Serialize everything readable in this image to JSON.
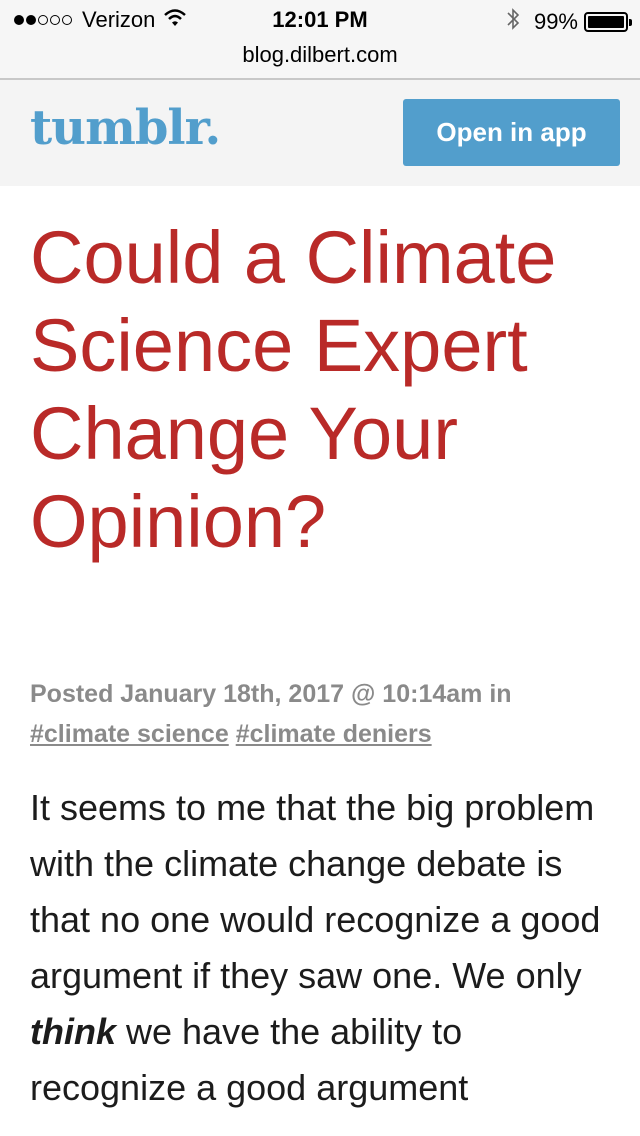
{
  "status_bar": {
    "carrier": "Verizon",
    "time": "12:01 PM",
    "battery": "99%",
    "icons": [
      "signal-dots",
      "wifi-icon",
      "bluetooth-icon",
      "battery-icon"
    ]
  },
  "browser": {
    "url": "blog.dilbert.com"
  },
  "header": {
    "logo": "tumblr.",
    "open_app_label": "Open in app",
    "brand_color": "#529ecc"
  },
  "post": {
    "title": "Could a Climate Science Expert Change Your Opinion?",
    "title_color": "#b92a28",
    "meta": {
      "posted_text": "Posted January 18th, 2017 @ 10:14am in",
      "tags": [
        "#climate science",
        "#climate deniers"
      ]
    },
    "body": {
      "before_emphasis": "It seems to me that the big problem with the climate change debate is that no one would recognize a good argument if they saw one. We only ",
      "emphasis": "think",
      "after_emphasis": " we have the ability to recognize a good argument"
    }
  }
}
